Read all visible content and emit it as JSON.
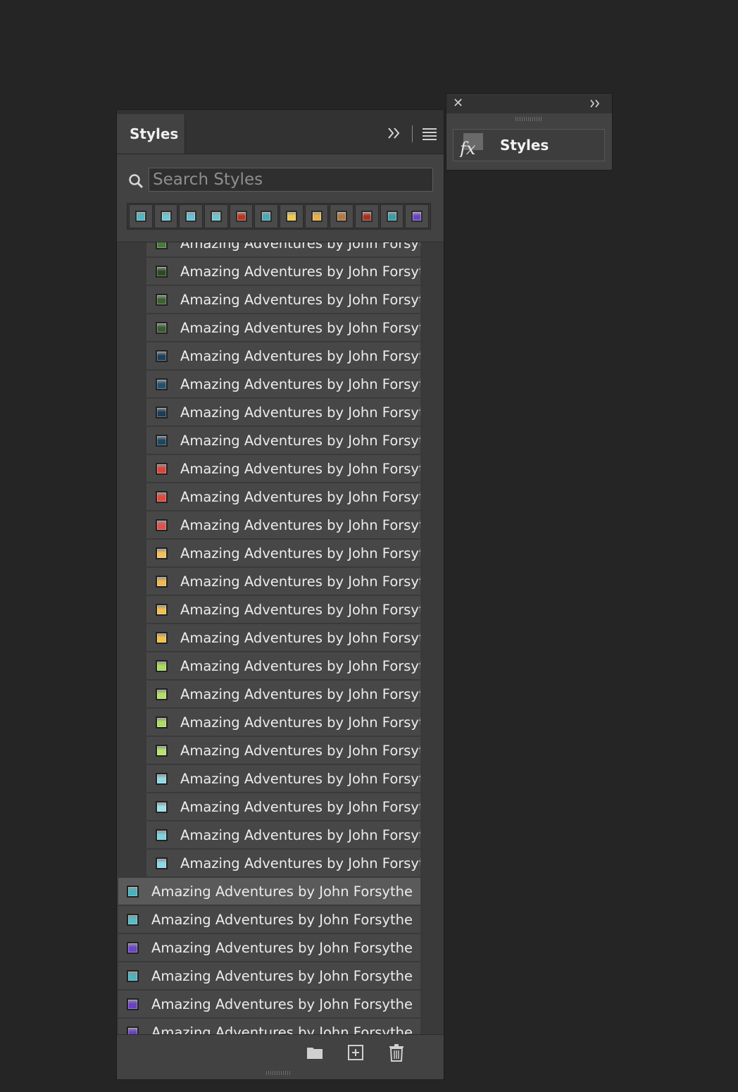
{
  "panel": {
    "tab_label": "Styles",
    "search_placeholder": "Search Styles",
    "swatches": [
      {
        "color": "#4fb6c2",
        "icon": "style-swatch-icon"
      },
      {
        "color": "#6cc7d6",
        "icon": "style-swatch-icon"
      },
      {
        "color": "#63c3d6",
        "icon": "style-swatch-icon"
      },
      {
        "color": "#6fc6cf",
        "icon": "style-swatch-icon"
      },
      {
        "color": "#b9361f",
        "icon": "style-swatch-icon"
      },
      {
        "color": "#4aa9b3",
        "icon": "style-swatch-icon"
      },
      {
        "color": "#f0c84a",
        "icon": "style-swatch-icon"
      },
      {
        "color": "#e8b040",
        "icon": "style-swatch-icon"
      },
      {
        "color": "#b3783c",
        "icon": "style-swatch-icon"
      },
      {
        "color": "#a6321d",
        "icon": "style-swatch-icon"
      },
      {
        "color": "#3e9aa6",
        "icon": "style-swatch-icon"
      },
      {
        "color": "#6a44c8",
        "icon": "style-swatch-icon"
      }
    ],
    "nested_items": [
      {
        "label": "Amazing Adventures by John Forsyt",
        "color": "#4a7a3a"
      },
      {
        "label": "Amazing Adventures by John Forsyt",
        "color": "#2c4a22"
      },
      {
        "label": "Amazing Adventures by John Forsyt",
        "color": "#3d6030"
      },
      {
        "label": "Amazing Adventures by John Forsyt",
        "color": "#3a5c2e"
      },
      {
        "label": "Amazing Adventures by John Forsyt",
        "color": "#1f3f5a"
      },
      {
        "label": "Amazing Adventures by John Forsyt",
        "color": "#24506e"
      },
      {
        "label": "Amazing Adventures by John Forsyt",
        "color": "#1c3c58"
      },
      {
        "label": "Amazing Adventures by John Forsyt",
        "color": "#1e4662"
      },
      {
        "label": "Amazing Adventures by John Forsyt",
        "color": "#d9453a"
      },
      {
        "label": "Amazing Adventures by John Forsyt",
        "color": "#e04a3c"
      },
      {
        "label": "Amazing Adventures by John Forsyt",
        "color": "#e2504a"
      },
      {
        "label": "Amazing Adventures by John Forsyt",
        "color": "#f2c25a"
      },
      {
        "label": "Amazing Adventures by John Forsyt",
        "color": "#f0b84e"
      },
      {
        "label": "Amazing Adventures by John Forsyt",
        "color": "#f2bf52"
      },
      {
        "label": "Amazing Adventures by John Forsyt",
        "color": "#f3c048"
      },
      {
        "label": "Amazing Adventures by John Forsyt",
        "color": "#a8dc5a"
      },
      {
        "label": "Amazing Adventures by John Forsyt",
        "color": "#b2e066"
      },
      {
        "label": "Amazing Adventures by John Forsyt",
        "color": "#acdd62"
      },
      {
        "label": "Amazing Adventures by John Forsyt",
        "color": "#b6e46c"
      },
      {
        "label": "Amazing Adventures by John Forsyt",
        "color": "#8fdbe6"
      },
      {
        "label": "Amazing Adventures by John Forsyt",
        "color": "#9be0ea"
      },
      {
        "label": "Amazing Adventures by John Forsyt",
        "color": "#7fd2e2"
      },
      {
        "label": "Amazing Adventures by John Forsyt",
        "color": "#8cd8e8"
      }
    ],
    "top_items": [
      {
        "label": "Amazing Adventures by John Forsythe",
        "color": "#45b3bf",
        "selected": true
      },
      {
        "label": "Amazing Adventures by John Forsythe",
        "color": "#58bcc6",
        "selected": false
      },
      {
        "label": "Amazing Adventures by John Forsythe",
        "color": "#6b46c9",
        "selected": false
      },
      {
        "label": "Amazing Adventures by John Forsythe",
        "color": "#4fb2bc",
        "selected": false
      },
      {
        "label": "Amazing Adventures by John Forsythe",
        "color": "#6a40c6",
        "selected": false
      },
      {
        "label": "Amazing Adventures by John Forsythe",
        "color": "#6a40c6",
        "selected": false
      }
    ],
    "footer_buttons": [
      "new-group-folder-icon",
      "new-style-icon",
      "delete-trash-icon"
    ]
  },
  "mini_panel": {
    "label": "Styles"
  }
}
